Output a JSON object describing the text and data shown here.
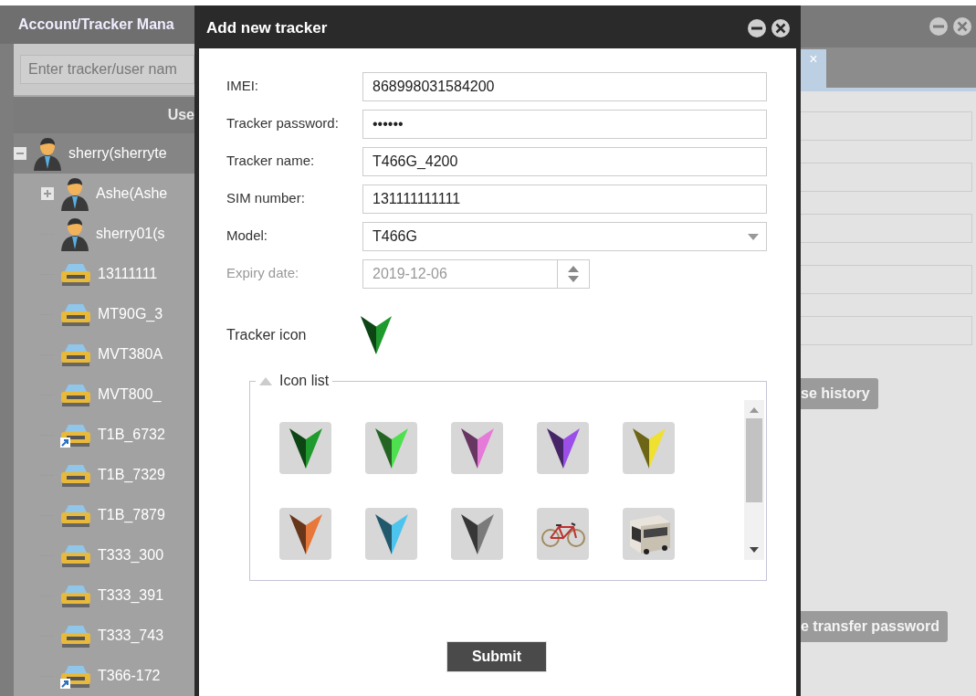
{
  "left_panel": {
    "title": "Account/Tracker Mana",
    "search": {
      "placeholder": "Enter tracker/user nam"
    },
    "column_header": "Use",
    "tree": [
      {
        "label": "sherry(sherryte",
        "kind": "user",
        "expanded": true,
        "selected": true,
        "children": [
          {
            "label": "Ashe(Ashe",
            "kind": "user",
            "expanded": false,
            "selected": false
          },
          {
            "label": "sherry01(s",
            "kind": "user",
            "selected": false
          },
          {
            "label": "13111111",
            "kind": "car",
            "shared": false,
            "selected": false
          },
          {
            "label": "MT90G_3",
            "kind": "car",
            "shared": false,
            "selected": false
          },
          {
            "label": "MVT380A",
            "kind": "car",
            "shared": false,
            "selected": false
          },
          {
            "label": "MVT800_",
            "kind": "car",
            "shared": false,
            "selected": false
          },
          {
            "label": "T1B_6732",
            "kind": "car",
            "shared": true,
            "selected": false
          },
          {
            "label": "T1B_7329",
            "kind": "car",
            "shared": false,
            "selected": false
          },
          {
            "label": "T1B_7879",
            "kind": "car",
            "shared": false,
            "selected": false
          },
          {
            "label": "T333_300",
            "kind": "car",
            "shared": false,
            "selected": false
          },
          {
            "label": "T333_391",
            "kind": "car",
            "shared": false,
            "selected": false
          },
          {
            "label": "T333_743",
            "kind": "car",
            "shared": false,
            "selected": false
          },
          {
            "label": "T366-172",
            "kind": "car",
            "shared": true,
            "selected": false
          }
        ]
      }
    ]
  },
  "dialog": {
    "title": "Add new tracker",
    "fields": [
      {
        "label": "IMEI:",
        "kind": "text",
        "value": "868998031584200",
        "disabled": false
      },
      {
        "label": "Tracker password:",
        "kind": "password",
        "value": "••••••",
        "disabled": false
      },
      {
        "label": "Tracker name:",
        "kind": "text",
        "value": "T466G_4200",
        "disabled": false
      },
      {
        "label": "SIM number:",
        "kind": "text",
        "value": "131111111111",
        "disabled": false
      },
      {
        "label": "Model:",
        "kind": "select",
        "value": "T466G",
        "disabled": false
      },
      {
        "label": "Expiry date:",
        "kind": "date",
        "value": "2019-12-06",
        "disabled": true
      }
    ],
    "tracker_icon": {
      "label": "Tracker icon",
      "color": "#1f9a2c"
    },
    "icon_list": {
      "legend": "Icon list",
      "expanded": true,
      "items": [
        {
          "kind": "arrow",
          "color": "#1f9a2c"
        },
        {
          "kind": "arrow",
          "color": "#4fe04f"
        },
        {
          "kind": "arrow",
          "color": "#e57ad8"
        },
        {
          "kind": "arrow",
          "color": "#9b4fe8"
        },
        {
          "kind": "arrow",
          "color": "#f0e030"
        },
        {
          "kind": "arrow",
          "color": "#e8773a"
        },
        {
          "kind": "arrow",
          "color": "#4cc4ee"
        },
        {
          "kind": "arrow",
          "color": "#7a7a7a"
        },
        {
          "kind": "bicycle"
        },
        {
          "kind": "bus"
        }
      ]
    },
    "submit": "Submit"
  },
  "right_panel": {
    "tab_close": "×",
    "buttons": [
      "se history",
      "e transfer password"
    ]
  }
}
